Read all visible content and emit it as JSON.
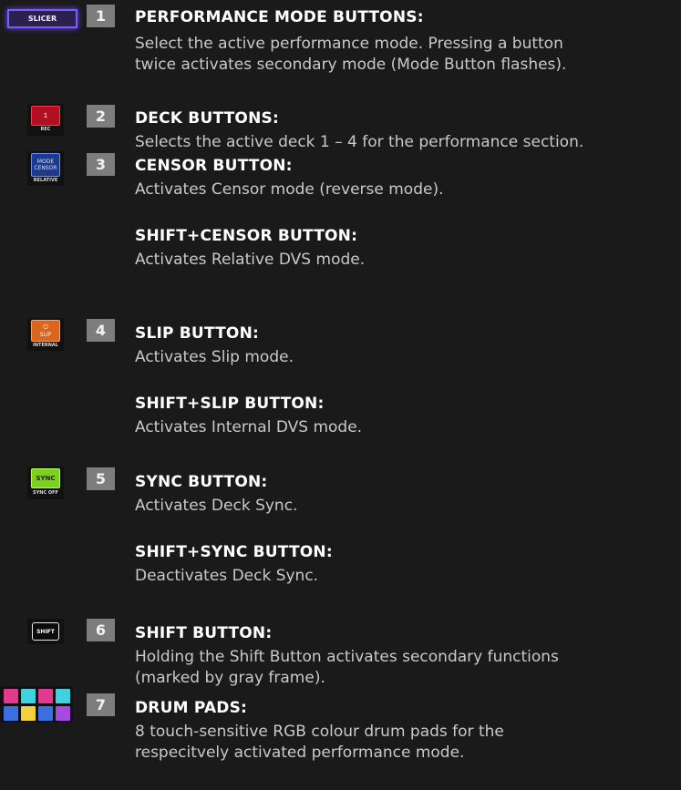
{
  "items": [
    {
      "number": "1",
      "title": "PERFORMANCE MODE BUTTONS:",
      "lines": [
        "Select the active performance mode. Pressing a button",
        "twice activates secondary mode (Mode Button flashes)."
      ],
      "icon": {
        "name": "slicer-button-icon",
        "label": "SLICER",
        "color": "#7a5cff"
      }
    },
    {
      "number": "2",
      "title": "DECK BUTTONS:",
      "lines": [
        "Selects the active deck 1 – 4 for the performance section."
      ],
      "icon": {
        "name": "deck-button-icon",
        "label": "1",
        "sublabel": "REC",
        "color": "#b0101f"
      }
    },
    {
      "number": "3",
      "title": "CENSOR BUTTON:",
      "lines": [
        "Activates Censor mode (reverse mode)."
      ],
      "subtitle": "SHIFT+CENSOR BUTTON:",
      "sublines": [
        "Activates Relative DVS mode."
      ],
      "icon": {
        "name": "censor-button-icon",
        "label_top": "MODE",
        "label_bottom": "CENSOR",
        "sublabel": "RELATIVE",
        "color": "#203a8a"
      }
    },
    {
      "number": "4",
      "title": "SLIP BUTTON:",
      "lines": [
        "Activates Slip mode."
      ],
      "subtitle": "SHIFT+SLIP BUTTON:",
      "sublines": [
        "Activates Internal DVS mode."
      ],
      "icon": {
        "name": "slip-button-icon",
        "label": "SLIP",
        "sublabel": "INTERNAL",
        "color": "#d9651f"
      }
    },
    {
      "number": "5",
      "title": "SYNC BUTTON:",
      "lines": [
        "Activates Deck Sync."
      ],
      "subtitle": "SHIFT+SYNC BUTTON:",
      "sublines": [
        "Deactivates Deck Sync."
      ],
      "icon": {
        "name": "sync-button-icon",
        "label": "SYNC",
        "sublabel": "SYNC OFF",
        "color": "#7bd11f"
      }
    },
    {
      "number": "6",
      "title": "SHIFT BUTTON:",
      "lines": [
        "Holding the Shift Button activates secondary functions",
        "(marked by gray frame)."
      ],
      "icon": {
        "name": "shift-button-icon",
        "label": "SHIFT",
        "color": "#e6e6e6"
      }
    },
    {
      "number": "7",
      "title": "DRUM PADS:",
      "lines": [
        "8 touch-sensitive RGB colour drum pads for the",
        "respecitvely activated performance mode."
      ],
      "icon": {
        "name": "drum-pads-icon",
        "pad_colors": [
          "#e23a8f",
          "#3fd3e0",
          "#e23a8f",
          "#3fd3e0",
          "#3a6fe2",
          "#f2d23a",
          "#3a6fe2",
          "#a84ae2"
        ]
      }
    }
  ]
}
